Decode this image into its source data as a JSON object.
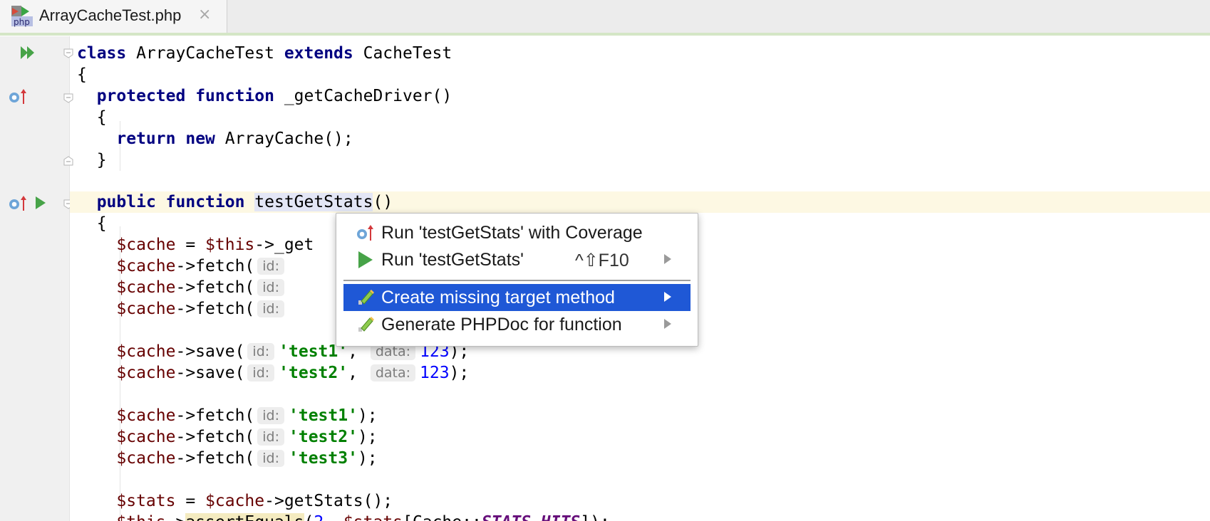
{
  "tab": {
    "title": "ArrayCacheTest.php",
    "close_glyph": "×",
    "icon": "php-file-icon",
    "icon_text": "php"
  },
  "colors": {
    "keyword": "#000080",
    "variable": "#660000",
    "string": "#008000",
    "number": "#0000ff",
    "selection": "#1f58d6"
  },
  "code": {
    "l1": {
      "kw1": "class",
      "name": " ArrayCacheTest ",
      "kw2": "extends",
      "rest": " CacheTest"
    },
    "l2": "{",
    "l3": {
      "kw1": "protected",
      "kw2": "function",
      "rest": " _getCacheDriver()"
    },
    "l4": "{",
    "l5": {
      "kw1": "return",
      "kw2": "new",
      "rest": " ArrayCache();"
    },
    "l6": "}",
    "l8": {
      "kw1": "public",
      "kw2": "function",
      "name": "testGetStats",
      "rest": "()"
    },
    "l9": "{",
    "l10": {
      "var1": "$cache",
      "eq": " = ",
      "var2": "$this",
      "rest": "->_get"
    },
    "l11": {
      "var": "$cache",
      "rest": "->fetch(",
      "hint": "id:"
    },
    "l12": {
      "var": "$cache",
      "rest": "->fetch(",
      "hint": "id:"
    },
    "l13": {
      "var": "$cache",
      "rest": "->fetch(",
      "hint": "id:"
    },
    "l15": {
      "var": "$cache",
      "rest": "->save(",
      "hint1": "id:",
      "str": "'test1'",
      "comma": ", ",
      "hint2": "data:",
      "num": "123",
      "end": ");"
    },
    "l16": {
      "var": "$cache",
      "rest": "->save(",
      "hint1": "id:",
      "str": "'test2'",
      "comma": ", ",
      "hint2": "data:",
      "num": "123",
      "end": ");"
    },
    "l18": {
      "var": "$cache",
      "rest": "->fetch(",
      "hint": "id:",
      "str": "'test1'",
      "end": ");"
    },
    "l19": {
      "var": "$cache",
      "rest": "->fetch(",
      "hint": "id:",
      "str": "'test2'",
      "end": ");"
    },
    "l20": {
      "var": "$cache",
      "rest": "->fetch(",
      "hint": "id:",
      "str": "'test3'",
      "end": ");"
    },
    "l22": {
      "var1": "$stats",
      "eq": " = ",
      "var2": "$cache",
      "rest": "->getStats();"
    },
    "l23": {
      "var1": "$this",
      "arrow": "->",
      "method": "assertEquals",
      "open": "(",
      "num": "2",
      "comma": ", ",
      "var2": "$stats",
      "mid": "[Cache::",
      "const": "STATS_HITS",
      "end": "]);"
    }
  },
  "popup": {
    "items": [
      {
        "label": "Run 'testGetStats' with Coverage",
        "icon": "coverage-icon",
        "shortcut": ""
      },
      {
        "label": "Run 'testGetStats'",
        "icon": "run-icon",
        "shortcut": "^⇧F10"
      },
      {
        "label": "Create missing target method",
        "icon": "intention-bulb-icon",
        "shortcut": ""
      },
      {
        "label": "Generate PHPDoc for function",
        "icon": "pencil-icon",
        "shortcut": ""
      }
    ],
    "selected_index": 2
  }
}
